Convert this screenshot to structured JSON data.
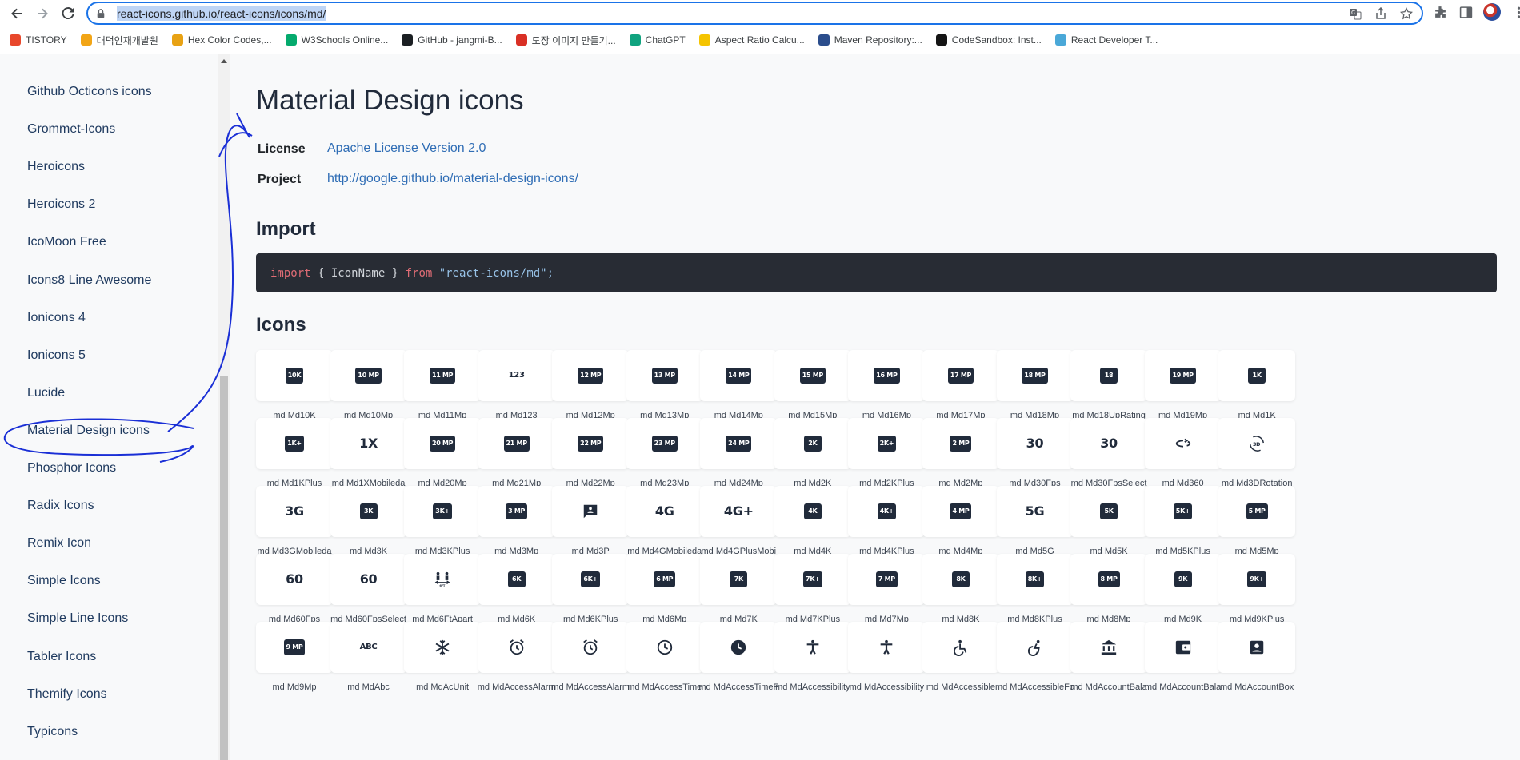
{
  "browser": {
    "url": "react-icons.github.io/react-icons/icons/md/",
    "bookmarks": [
      {
        "label": "TISTORY",
        "color": "#e8472b",
        "icon": "tistory-icon"
      },
      {
        "label": "대덕인재개발원",
        "color": "#f2a516",
        "icon": "pencil-logo-icon"
      },
      {
        "label": "Hex Color Codes,...",
        "color": "#e8a214",
        "icon": "palette-icon"
      },
      {
        "label": "W3Schools Online...",
        "color": "#04aa6d",
        "icon": "w3schools-icon"
      },
      {
        "label": "GitHub - jangmi-B...",
        "color": "#1b1f23",
        "icon": "github-icon"
      },
      {
        "label": "도장 이미지 만들기...",
        "color": "#d93025",
        "icon": "stamp-icon"
      },
      {
        "label": "ChatGPT",
        "color": "#10a37f",
        "icon": "chatgpt-icon"
      },
      {
        "label": "Aspect Ratio Calcu...",
        "color": "#f5c400",
        "icon": "aspect-ratio-icon"
      },
      {
        "label": "Maven Repository:...",
        "color": "#2b4d8c",
        "icon": "maven-icon"
      },
      {
        "label": "CodeSandbox: Inst...",
        "color": "#151515",
        "icon": "codesandbox-icon"
      },
      {
        "label": "React Developer T...",
        "color": "#4aa8d8",
        "icon": "react-icon"
      }
    ]
  },
  "sidebar": {
    "items": [
      "Github Octicons icons",
      "Grommet-Icons",
      "Heroicons",
      "Heroicons 2",
      "IcoMoon Free",
      "Icons8 Line Awesome",
      "Ionicons 4",
      "Ionicons 5",
      "Lucide",
      "Material Design icons",
      "Phosphor Icons",
      "Radix Icons",
      "Remix Icon",
      "Simple Icons",
      "Simple Line Icons",
      "Tabler Icons",
      "Themify Icons",
      "Typicons"
    ],
    "active": "Material Design icons"
  },
  "page": {
    "title": "Material Design icons",
    "license_label": "License",
    "license_value": "Apache License Version 2.0",
    "project_label": "Project",
    "project_value": "http://google.github.io/material-design-icons/",
    "import_heading": "Import",
    "code_kw1": "import",
    "code_mid": " { IconName } ",
    "code_kw2": "from",
    "code_str": "\"react-icons/md\";",
    "icons_heading": "Icons"
  },
  "icons": [
    {
      "name": "md Md10K",
      "glyph": "10K",
      "style": "box"
    },
    {
      "name": "md Md10Mp",
      "glyph": "10 MP",
      "style": "box"
    },
    {
      "name": "md Md11Mp",
      "glyph": "11 MP",
      "style": "box"
    },
    {
      "name": "md Md123",
      "glyph": "123",
      "style": "plain-sm"
    },
    {
      "name": "md Md12Mp",
      "glyph": "12 MP",
      "style": "box"
    },
    {
      "name": "md Md13Mp",
      "glyph": "13 MP",
      "style": "box"
    },
    {
      "name": "md Md14Mp",
      "glyph": "14 MP",
      "style": "box"
    },
    {
      "name": "md Md15Mp",
      "glyph": "15 MP",
      "style": "box"
    },
    {
      "name": "md Md16Mp",
      "glyph": "16 MP",
      "style": "box"
    },
    {
      "name": "md Md17Mp",
      "glyph": "17 MP",
      "style": "box"
    },
    {
      "name": "md Md18Mp",
      "glyph": "18 MP",
      "style": "box"
    },
    {
      "name": "md Md18UpRating",
      "glyph": "18",
      "style": "box"
    },
    {
      "name": "md Md19Mp",
      "glyph": "19 MP",
      "style": "box"
    },
    {
      "name": "md Md1K",
      "glyph": "1K",
      "style": "box"
    },
    {
      "name": "md Md1KPlus",
      "glyph": "1K+",
      "style": "box"
    },
    {
      "name": "md Md1XMobileda",
      "glyph": "1X",
      "style": "plain"
    },
    {
      "name": "md Md20Mp",
      "glyph": "20 MP",
      "style": "box"
    },
    {
      "name": "md Md21Mp",
      "glyph": "21 MP",
      "style": "box"
    },
    {
      "name": "md Md22Mp",
      "glyph": "22 MP",
      "style": "box"
    },
    {
      "name": "md Md23Mp",
      "glyph": "23 MP",
      "style": "box"
    },
    {
      "name": "md Md24Mp",
      "glyph": "24 MP",
      "style": "box"
    },
    {
      "name": "md Md2K",
      "glyph": "2K",
      "style": "box"
    },
    {
      "name": "md Md2KPlus",
      "glyph": "2K+",
      "style": "box"
    },
    {
      "name": "md Md2Mp",
      "glyph": "2 MP",
      "style": "box"
    },
    {
      "name": "md Md30Fps",
      "glyph": "30",
      "style": "plain"
    },
    {
      "name": "md Md30FpsSelect",
      "glyph": "30",
      "style": "plain"
    },
    {
      "name": "md Md360",
      "glyph": "360",
      "style": "svg-360"
    },
    {
      "name": "md Md3DRotation",
      "glyph": "3D",
      "style": "svg-3d"
    },
    {
      "name": "md Md3GMobileda",
      "glyph": "3G",
      "style": "plain"
    },
    {
      "name": "md Md3K",
      "glyph": "3K",
      "style": "box"
    },
    {
      "name": "md Md3KPlus",
      "glyph": "3K+",
      "style": "box"
    },
    {
      "name": "md Md3Mp",
      "glyph": "3 MP",
      "style": "box"
    },
    {
      "name": "md Md3P",
      "glyph": "3P",
      "style": "svg-chat"
    },
    {
      "name": "md Md4GMobileda",
      "glyph": "4G",
      "style": "plain"
    },
    {
      "name": "md Md4GPlusMobi",
      "glyph": "4G+",
      "style": "plain"
    },
    {
      "name": "md Md4K",
      "glyph": "4K",
      "style": "box"
    },
    {
      "name": "md Md4KPlus",
      "glyph": "4K+",
      "style": "box"
    },
    {
      "name": "md Md4Mp",
      "glyph": "4 MP",
      "style": "box"
    },
    {
      "name": "md Md5G",
      "glyph": "5G",
      "style": "plain"
    },
    {
      "name": "md Md5K",
      "glyph": "5K",
      "style": "box"
    },
    {
      "name": "md Md5KPlus",
      "glyph": "5K+",
      "style": "box"
    },
    {
      "name": "md Md5Mp",
      "glyph": "5 MP",
      "style": "box"
    },
    {
      "name": "md Md60Fps",
      "glyph": "60",
      "style": "plain"
    },
    {
      "name": "md Md60FpsSelect",
      "glyph": "60",
      "style": "plain"
    },
    {
      "name": "md Md6FtApart",
      "glyph": "6FT",
      "style": "svg-people"
    },
    {
      "name": "md Md6K",
      "glyph": "6K",
      "style": "box"
    },
    {
      "name": "md Md6KPlus",
      "glyph": "6K+",
      "style": "box"
    },
    {
      "name": "md Md6Mp",
      "glyph": "6 MP",
      "style": "box"
    },
    {
      "name": "md Md7K",
      "glyph": "7K",
      "style": "box"
    },
    {
      "name": "md Md7KPlus",
      "glyph": "7K+",
      "style": "box"
    },
    {
      "name": "md Md7Mp",
      "glyph": "7 MP",
      "style": "box"
    },
    {
      "name": "md Md8K",
      "glyph": "8K",
      "style": "box"
    },
    {
      "name": "md Md8KPlus",
      "glyph": "8K+",
      "style": "box"
    },
    {
      "name": "md Md8Mp",
      "glyph": "8 MP",
      "style": "box"
    },
    {
      "name": "md Md9K",
      "glyph": "9K",
      "style": "box"
    },
    {
      "name": "md Md9KPlus",
      "glyph": "9K+",
      "style": "box"
    },
    {
      "name": "md Md9Mp",
      "glyph": "9 MP",
      "style": "box"
    },
    {
      "name": "md MdAbc",
      "glyph": "ABC",
      "style": "plain-sm"
    },
    {
      "name": "md MdAcUnit",
      "glyph": "snow",
      "style": "svg-snow"
    },
    {
      "name": "md MdAccessAlarm",
      "glyph": "alarm",
      "style": "svg-alarm"
    },
    {
      "name": "md MdAccessAlarm",
      "glyph": "alarm",
      "style": "svg-alarm"
    },
    {
      "name": "md MdAccessTime",
      "glyph": "time",
      "style": "svg-clock"
    },
    {
      "name": "md MdAccessTimeF",
      "glyph": "time",
      "style": "svg-clock-filled"
    },
    {
      "name": "md MdAccessibility",
      "glyph": "person",
      "style": "svg-person"
    },
    {
      "name": "md MdAccessibility",
      "glyph": "person",
      "style": "svg-person"
    },
    {
      "name": "md MdAccessible",
      "glyph": "wheelchair",
      "style": "svg-wheel"
    },
    {
      "name": "md MdAccessibleFo",
      "glyph": "wheelchair",
      "style": "svg-wheel2"
    },
    {
      "name": "md MdAccountBala",
      "glyph": "bank",
      "style": "svg-bank"
    },
    {
      "name": "md MdAccountBala",
      "glyph": "wallet",
      "style": "svg-wallet"
    },
    {
      "name": "md MdAccountBox",
      "glyph": "account",
      "style": "svg-account"
    }
  ]
}
